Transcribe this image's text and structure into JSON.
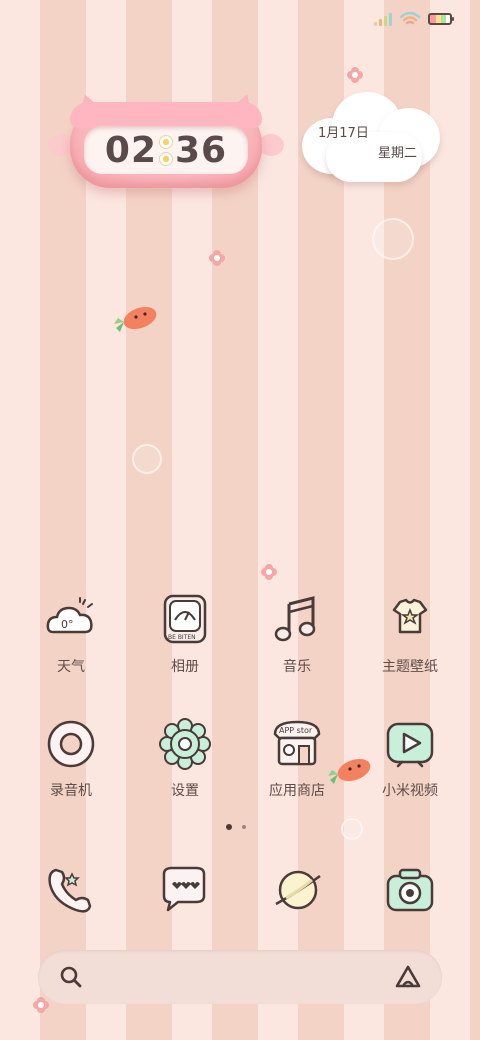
{
  "status_bar": {
    "signal_icon": "signal-bars-icon",
    "wifi_icon": "wifi-icon",
    "battery_icon": "battery-icon"
  },
  "clock": {
    "hours": "02",
    "minutes": "36"
  },
  "date": {
    "date": "1月17日",
    "weekday": "星期二"
  },
  "apps_row1": [
    {
      "label": "天气",
      "icon": "weather-cloud-icon"
    },
    {
      "label": "相册",
      "icon": "gallery-icon"
    },
    {
      "label": "音乐",
      "icon": "music-note-icon"
    },
    {
      "label": "主题壁纸",
      "icon": "theme-shirt-icon"
    }
  ],
  "apps_row2": [
    {
      "label": "录音机",
      "icon": "recorder-icon"
    },
    {
      "label": "设置",
      "icon": "settings-gear-icon"
    },
    {
      "label": "应用商店",
      "icon": "app-store-icon",
      "icon_text": "APP stor"
    },
    {
      "label": "小米视频",
      "icon": "video-play-icon"
    }
  ],
  "gallery_icon_text": "BE BITEN",
  "page_indicator": {
    "total": 2,
    "current": 1
  },
  "dock": [
    {
      "icon": "phone-icon"
    },
    {
      "icon": "messages-icon"
    },
    {
      "icon": "browser-planet-icon"
    },
    {
      "icon": "camera-icon"
    }
  ],
  "search": {
    "search_icon": "search-icon",
    "assistant_icon": "assistant-icon"
  },
  "colors": {
    "stripe_light": "#fbe6e0",
    "stripe_dark": "#f3d3c6",
    "icon_outline": "#4a3a38",
    "mint": "#c8efd9",
    "text": "#5f4d4a"
  }
}
